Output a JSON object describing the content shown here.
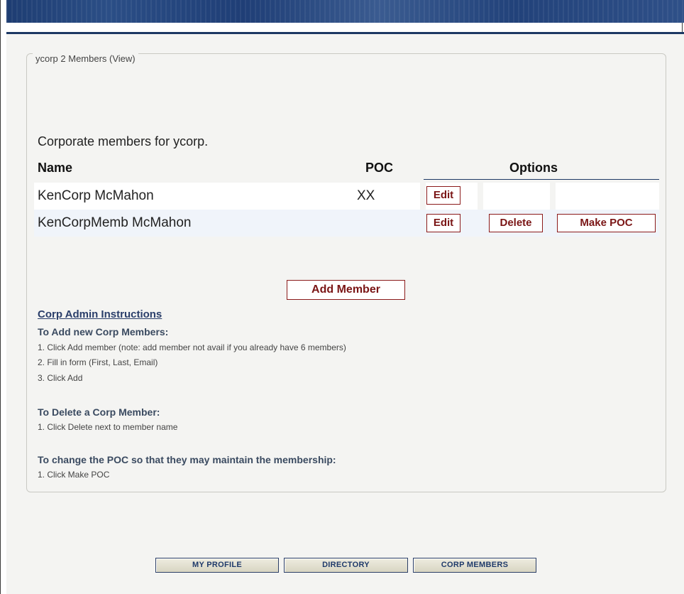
{
  "panel": {
    "legend": "ycorp 2 Members (View)",
    "intro": "Corporate members for ycorp."
  },
  "table": {
    "headers": {
      "name": "Name",
      "poc": "POC",
      "options": "Options"
    },
    "rows": [
      {
        "name": "KenCorp McMahon",
        "poc": "XX",
        "edit": "Edit",
        "delete": "",
        "make_poc": ""
      },
      {
        "name": "KenCorpMemb McMahon",
        "poc": "",
        "edit": "Edit",
        "delete": "Delete",
        "make_poc": "Make POC"
      }
    ]
  },
  "actions": {
    "add_member": "Add Member"
  },
  "instructions": {
    "title": "Corp Admin Instructions",
    "add_heading": "To Add new Corp Members:",
    "add_steps": [
      "1. Click Add member (note: add member not avail if you already have 6 members)",
      "2. Fill in form (First, Last, Email)",
      "3. Click Add"
    ],
    "delete_heading": "To Delete a Corp Member:",
    "delete_steps": [
      "1. Click Delete next to member name"
    ],
    "poc_heading": "To change the POC so that they may maintain the membership:",
    "poc_steps": [
      "1. Click Make POC"
    ]
  },
  "nav": {
    "my_profile": "MY PROFILE",
    "directory": "DIRECTORY",
    "corp_members": "CORP MEMBERS"
  },
  "colors": {
    "banner": "#1e3d72",
    "button_border": "#8b1a1a",
    "button_text": "#7a1515",
    "nav_text": "#1f3a6a"
  }
}
